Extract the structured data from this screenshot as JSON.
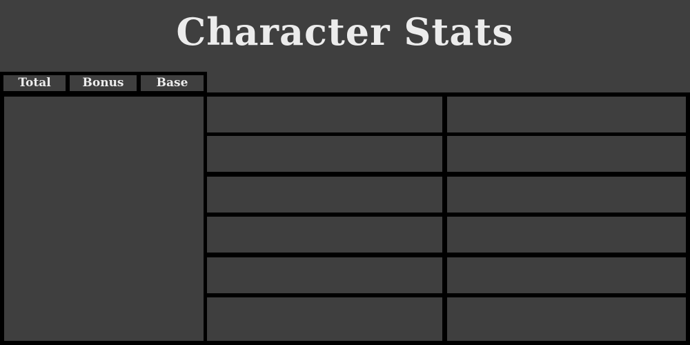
{
  "header": {
    "title": "Character Stats"
  },
  "tabs": [
    {
      "label": "Total"
    },
    {
      "label": "Bonus"
    },
    {
      "label": "Base"
    }
  ],
  "colors": {
    "background": "#3f3f3f",
    "border": "#000000",
    "text": "#ececec"
  }
}
